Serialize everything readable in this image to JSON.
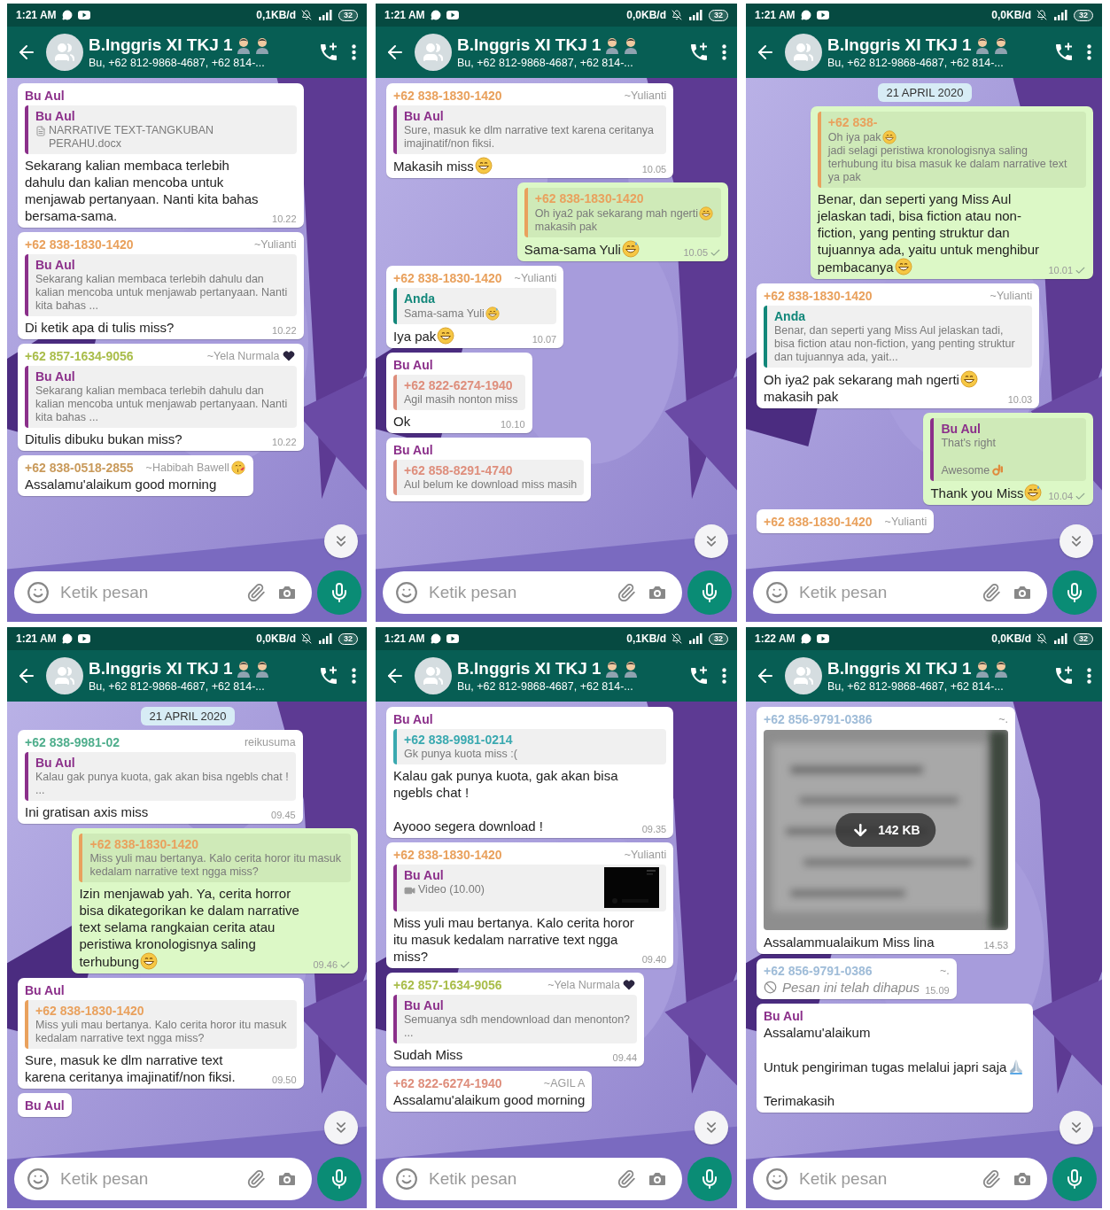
{
  "panels": [
    {
      "status_bar": {
        "time": "1:21 AM",
        "speed": "0,1KB/d",
        "battery": "32"
      },
      "header": {
        "title": "B.Inggris XI TKJ 1",
        "subtitle": "Bu, +62 812-9868-4687, +62 814-..."
      },
      "messages": [
        {
          "outgoing": false,
          "kind": "text",
          "sender": {
            "name": "Bu Aul",
            "color": "#8b2f8a"
          },
          "quote": {
            "author": {
              "name": "Bu Aul",
              "color": "#8b2f8a"
            },
            "attachment": {
              "kind": "document"
            },
            "body": [
              {
                "text": "NARRATIVE TEXT-TANGKUBAN PERAHU.docx"
              }
            ]
          },
          "body": [
            {
              "text": "Sekarang kalian membaca terlebih dahulu dan kalian mencoba untuk menjawab pertanyaan. Nanti kita bahas bersama-sama."
            }
          ],
          "time": "10.22",
          "tick": false
        },
        {
          "outgoing": false,
          "kind": "text",
          "sender": {
            "name": "+62 838-1830-1420",
            "color": "#e9a15d"
          },
          "alias": "~Yulianti",
          "quote": {
            "author": {
              "name": "Bu Aul",
              "color": "#8b2f8a"
            },
            "body": [
              {
                "text": "Sekarang kalian membaca terlebih dahulu dan kalian mencoba untuk menjawab pertanyaan. Nanti kita bahas ..."
              }
            ]
          },
          "body": [
            {
              "text": "Di ketik apa di tulis miss?"
            }
          ],
          "time": "10.22",
          "tick": false
        },
        {
          "outgoing": false,
          "kind": "text",
          "sender": {
            "name": "+62 857-1634-9056",
            "color": "#a9bd4a"
          },
          "alias": "~Yela Nurmala",
          "alias_icon": {
            "kind": "heart"
          },
          "quote": {
            "author": {
              "name": "Bu Aul",
              "color": "#8b2f8a"
            },
            "body": [
              {
                "text": "Sekarang kalian membaca terlebih dahulu dan kalian mencoba untuk menjawab pertanyaan. Nanti kita bahas ..."
              }
            ]
          },
          "body": [
            {
              "text": "Ditulis dibuku bukan miss?"
            }
          ],
          "time": "10.22",
          "tick": false
        },
        {
          "outgoing": false,
          "kind": "text",
          "sender": {
            "name": "+62 838-0518-2855",
            "color": "#c99a5b"
          },
          "alias": "~Habibah Bawell",
          "alias_icon": {
            "kind": "kiss"
          },
          "body": [
            {
              "text": "Assalamu'alaikum good morning"
            }
          ],
          "tick": false
        }
      ],
      "composer": {
        "placeholder": "Ketik pesan"
      }
    },
    {
      "status_bar": {
        "time": "1:21 AM",
        "speed": "0,0KB/d",
        "battery": "32"
      },
      "header": {
        "title": "B.Inggris XI TKJ 1",
        "subtitle": "Bu, +62 812-9868-4687, +62 814-..."
      },
      "messages": [
        {
          "outgoing": false,
          "kind": "text",
          "sender": {
            "name": "+62 838-1830-1420",
            "color": "#e9a15d"
          },
          "alias": "~Yulianti",
          "quote": {
            "author": {
              "name": "Bu Aul",
              "color": "#8b2f8a"
            },
            "body": [
              {
                "text": "Sure, masuk ke dlm narrative text karena ceritanya imajinatif/non fiksi."
              }
            ]
          },
          "body": [
            {
              "text": "Makasih miss",
              "emoji": {
                "kind": "grin"
              }
            }
          ],
          "time": "10.05",
          "tick": false
        },
        {
          "outgoing": true,
          "kind": "text",
          "quote": {
            "author": {
              "name": "+62 838-1830-1420",
              "color": "#e9a15d"
            },
            "body": [
              {
                "text": "Oh iya2 pak sekarang mah ngerti",
                "emoji": {
                  "kind": "grin"
                }
              },
              {
                "text": "makasih pak"
              }
            ]
          },
          "body": [
            {
              "text": "Sama-sama Yuli",
              "emoji": {
                "kind": "sweat"
              }
            }
          ],
          "time": "10.05",
          "tick": true
        },
        {
          "outgoing": false,
          "kind": "text",
          "sender": {
            "name": "+62 838-1830-1420",
            "color": "#e9a15d"
          },
          "alias": "~Yulianti",
          "quote": {
            "author": {
              "name": "Anda",
              "color": "#12877a"
            },
            "body": [
              {
                "text": "Sama-sama Yuli",
                "emoji": {
                  "kind": "sweat"
                }
              }
            ]
          },
          "body": [
            {
              "text": "Iya pak",
              "emoji": {
                "kind": "grin"
              }
            }
          ],
          "time": "10.07",
          "tick": false
        },
        {
          "outgoing": false,
          "kind": "text",
          "sender": {
            "name": "Bu Aul",
            "color": "#8b2f8a"
          },
          "quote": {
            "author": {
              "name": "+62 822-6274-1940",
              "color": "#de8e7c"
            },
            "body": [
              {
                "text": "Agil masih nonton miss"
              }
            ]
          },
          "body": [
            {
              "text": "Ok"
            }
          ],
          "time": "10.10",
          "tick": false
        },
        {
          "outgoing": false,
          "kind": "text",
          "sender": {
            "name": "Bu Aul",
            "color": "#8b2f8a"
          },
          "quote": {
            "author": {
              "name": "+62 858-8291-4740",
              "color": "#de8e7c"
            },
            "body": [
              {
                "text": "Aul belum ke download miss masih"
              }
            ]
          },
          "tick": false
        }
      ],
      "composer": {
        "placeholder": "Ketik pesan"
      }
    },
    {
      "status_bar": {
        "time": "1:21 AM",
        "speed": "0,0KB/d",
        "battery": "32"
      },
      "header": {
        "title": "B.Inggris XI TKJ 1",
        "subtitle": "Bu, +62 812-9868-4687, +62 814-..."
      },
      "date_chip": "21 APRIL 2020",
      "messages": [
        {
          "outgoing": true,
          "kind": "text",
          "quote": {
            "author": {
              "name": "+62 838-",
              "color": "#e9a15d"
            },
            "body": [
              {
                "text": "Oh iya pak",
                "emoji": {
                  "kind": "grin"
                }
              },
              {
                "text": "jadi selagi peristiwa kronologisnya saling terhubung itu bisa masuk ke dalam narrative text ya pak"
              }
            ]
          },
          "body": [
            {
              "text": "Benar, dan seperti yang Miss Aul jelaskan tadi, bisa fiction atau non-fiction, yang penting struktur dan tujuannya ada, yaitu untuk menghibur"
            },
            {
              "text": "pembacanya",
              "emoji": {
                "kind": "grin"
              }
            }
          ],
          "time": "10.01",
          "tick": true
        },
        {
          "outgoing": false,
          "kind": "text",
          "sender": {
            "name": "+62 838-1830-1420",
            "color": "#e9a15d"
          },
          "alias": "~Yulianti",
          "quote": {
            "author": {
              "name": "Anda",
              "color": "#12877a"
            },
            "body": [
              {
                "text": "Benar, dan seperti yang Miss Aul jelaskan tadi, bisa fiction atau non-fiction, yang penting struktur dan tujuannya ada, yait..."
              }
            ]
          },
          "body": [
            {
              "text": "Oh iya2 pak sekarang mah ngerti",
              "emoji": {
                "kind": "grin"
              }
            },
            {
              "text": "makasih pak"
            }
          ],
          "time": "10.03",
          "tick": false
        },
        {
          "outgoing": true,
          "kind": "text",
          "quote": {
            "author": {
              "name": "Bu Aul",
              "color": "#8b2f8a"
            },
            "body": [
              {
                "text": "That's right"
              },
              {
                "text": "\nAwesome",
                "emoji": {
                  "kind": "ok"
                }
              }
            ]
          },
          "body": [
            {
              "text": "Thank you Miss",
              "emoji": {
                "kind": "sweat"
              }
            }
          ],
          "time": "10.04",
          "tick": true
        },
        {
          "outgoing": false,
          "kind": "text",
          "sender": {
            "name": "+62 838-1830-1420",
            "color": "#e9a15d"
          },
          "alias": "~Yulianti",
          "tick": false
        }
      ],
      "composer": {
        "placeholder": "Ketik pesan"
      }
    },
    {
      "status_bar": {
        "time": "1:21 AM",
        "speed": "0,0KB/d",
        "battery": "32"
      },
      "header": {
        "title": "B.Inggris XI TKJ 1",
        "subtitle": "Bu, +62 812-9868-4687, +62 814-..."
      },
      "date_chip": "21 APRIL 2020",
      "messages": [
        {
          "outgoing": false,
          "kind": "text",
          "sender": {
            "name": "+62 838-9981-02",
            "color": "#4fae8c"
          },
          "alias": "reikusuma",
          "quote": {
            "author": {
              "name": "Bu Aul",
              "color": "#8b2f8a"
            },
            "body": [
              {
                "text": "Kalau gak punya kuota, gak akan bisa ngebls chat !\n..."
              }
            ]
          },
          "body": [
            {
              "text": "Ini gratisan axis miss"
            }
          ],
          "time": "09.45",
          "tick": false
        },
        {
          "outgoing": true,
          "kind": "text",
          "quote": {
            "author": {
              "name": "+62 838-1830-1420",
              "color": "#e9a15d"
            },
            "body": [
              {
                "text": "Miss yuli mau bertanya. Kalo cerita horor itu masuk kedalam narrative text ngga miss?"
              }
            ]
          },
          "body": [
            {
              "text": "Izin menjawab yah. Ya, cerita horror bisa dikategorikan ke dalam narrative text selama rangkaian cerita atau peristiwa kronologisnya saling"
            },
            {
              "text": "terhubung",
              "emoji": {
                "kind": "grin"
              }
            }
          ],
          "time": "09.46",
          "tick": true
        },
        {
          "outgoing": false,
          "kind": "text",
          "sender": {
            "name": "Bu Aul",
            "color": "#8b2f8a"
          },
          "quote": {
            "author": {
              "name": "+62 838-1830-1420",
              "color": "#e9a15d"
            },
            "body": [
              {
                "text": "Miss yuli mau bertanya. Kalo cerita horor itu masuk kedalam narrative text ngga miss?"
              }
            ]
          },
          "body": [
            {
              "text": "Sure, masuk ke dlm narrative text karena ceritanya imajinatif/non fiksi."
            }
          ],
          "time": "09.50",
          "tick": false
        },
        {
          "outgoing": false,
          "kind": "text",
          "sender": {
            "name": "Bu Aul",
            "color": "#8b2f8a"
          },
          "tick": false
        }
      ],
      "composer": {
        "placeholder": "Ketik pesan"
      }
    },
    {
      "status_bar": {
        "time": "1:21 AM",
        "speed": "0,1KB/d",
        "battery": "32"
      },
      "header": {
        "title": "B.Inggris XI TKJ 1",
        "subtitle": "Bu, +62 812-9868-4687, +62 814-..."
      },
      "messages": [
        {
          "outgoing": false,
          "kind": "text",
          "sender": {
            "name": "Bu Aul",
            "color": "#8b2f8a"
          },
          "quote": {
            "author": {
              "name": "+62 838-9981-0214",
              "color": "#3aa9b0"
            },
            "body": [
              {
                "text": "Gk punya kuota miss :("
              }
            ]
          },
          "body": [
            {
              "text": "Kalau gak punya kuota, gak akan bisa ngebls chat !\n\nAyooo segera download !"
            }
          ],
          "time": "09.35",
          "tick": false
        },
        {
          "outgoing": false,
          "kind": "text",
          "sender": {
            "name": "+62 838-1830-1420",
            "color": "#e9a15d"
          },
          "alias": "~Yulianti",
          "quote": {
            "author": {
              "name": "Bu Aul",
              "color": "#8b2f8a"
            },
            "attachment": {
              "kind": "video"
            },
            "body": [
              {
                "text": "Video (10.00)"
              }
            ]
          },
          "body": [
            {
              "text": "Miss yuli mau bertanya. Kalo cerita horor itu masuk kedalam narrative text ngga miss?"
            }
          ],
          "time": "09.40",
          "tick": false
        },
        {
          "outgoing": false,
          "kind": "text",
          "sender": {
            "name": "+62 857-1634-9056",
            "color": "#a9bd4a"
          },
          "alias": "~Yela Nurmala",
          "alias_icon": {
            "kind": "heart"
          },
          "quote": {
            "author": {
              "name": "Bu Aul",
              "color": "#8b2f8a"
            },
            "body": [
              {
                "text": "Semuanya sdh mendownload dan menonton?\n..."
              }
            ]
          },
          "body": [
            {
              "text": "Sudah Miss"
            }
          ],
          "time": "09.44",
          "tick": false
        },
        {
          "outgoing": false,
          "kind": "text",
          "sender": {
            "name": "+62 822-6274-1940",
            "color": "#de8e7c"
          },
          "alias": "~AGIL A",
          "body": [
            {
              "text": "Assalamu'alaikum good morning"
            }
          ],
          "tick": false
        }
      ],
      "composer": {
        "placeholder": "Ketik pesan"
      }
    },
    {
      "status_bar": {
        "time": "1:22 AM",
        "speed": "0,0KB/d",
        "battery": "32"
      },
      "header": {
        "title": "B.Inggris XI TKJ 1",
        "subtitle": "Bu, +62 812-9868-4687, +62 814-..."
      },
      "messages": [
        {
          "outgoing": false,
          "kind": "media",
          "sender": {
            "name": "+62 856-9791-0386",
            "color": "#9fbcd8"
          },
          "alias": "~.",
          "media": {
            "kind": "picture",
            "size": "142 KB"
          },
          "body": [
            {
              "text": "Assalammualaikum Miss lina"
            }
          ],
          "time": "14.53",
          "tick": false
        },
        {
          "outgoing": false,
          "kind": "deleted",
          "sender": {
            "name": "+62 856-9791-0386",
            "color": "#9fbcd8"
          },
          "alias": "~.",
          "body": [
            {
              "text": "Pesan ini telah dihapus"
            }
          ],
          "time": "15.09",
          "tick": false
        },
        {
          "outgoing": false,
          "kind": "text",
          "sender": {
            "name": "Bu Aul",
            "color": "#8b2f8a"
          },
          "body": [
            {
              "text": "Assalamu'alaikum"
            },
            {
              "text": "\nUntuk pengiriman tugas melalui japri saja",
              "emoji": {
                "kind": "pray"
              }
            },
            {
              "text": "\nTerimakasih"
            }
          ],
          "tick": false
        }
      ],
      "composer": {
        "placeholder": "Ketik pesan"
      }
    }
  ]
}
